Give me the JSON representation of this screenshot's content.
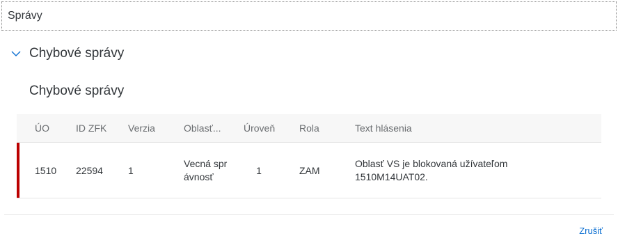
{
  "dialog": {
    "title": "Správy"
  },
  "panel": {
    "title": "Chybové správy"
  },
  "table": {
    "title": "Chybové správy",
    "columns": [
      "ÚO",
      "ID ZFK",
      "Verzia",
      "Oblasť...",
      "Úroveň",
      "Rola",
      "Text hlásenia"
    ],
    "rows": [
      {
        "status": "error",
        "uo": "1510",
        "id_zfk": "22594",
        "verzia": "1",
        "oblast": "Vecná správnosť",
        "uroven": "1",
        "rola": "ZAM",
        "text": "Oblasť VS je blokovaná užívateľom 1510M14UAT02."
      }
    ]
  },
  "footer": {
    "cancel_label": "Zrušiť"
  },
  "colors": {
    "error": "#bb0000",
    "link": "#0a6ed1"
  }
}
